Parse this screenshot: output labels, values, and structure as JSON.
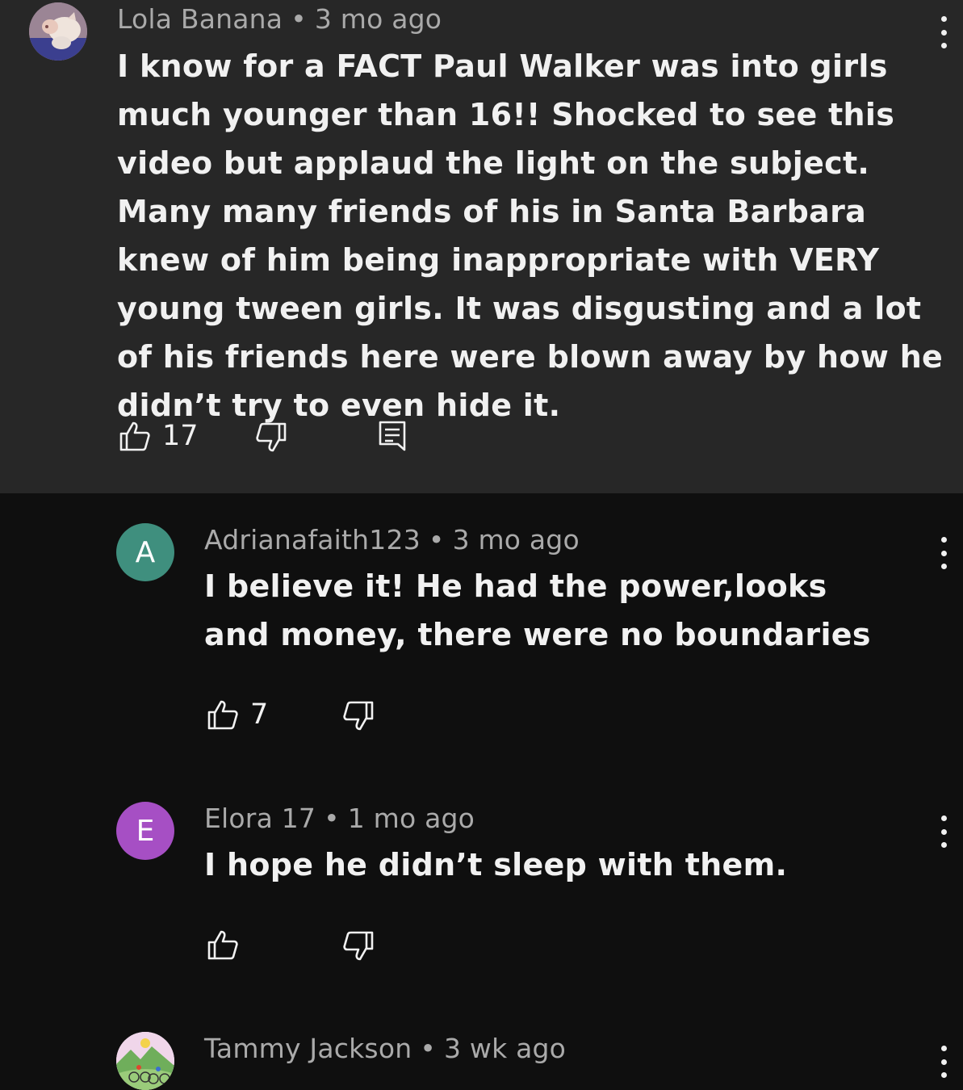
{
  "comments": [
    {
      "author": "Lola Banana",
      "time": "3 mo ago",
      "text": "I know for a FACT Paul Walker was into girls much younger than 16!! Shocked to see this video but applaud the light on the subject. Many many friends of his in Santa Barbara knew of him being inappropriate with VERY young tween girls. It was disgusting and a lot of his friends here were blown away by how he didn’t try to even hide it.",
      "likes": "17",
      "avatar_icon": "pig-photo-avatar"
    },
    {
      "author": "Adrianafaith123",
      "time": "3 mo ago",
      "text": "I believe it! He had the power,looks and money, there were no boundaries",
      "likes": "7",
      "avatar_letter": "A",
      "avatar_color": "#3f8f7e"
    },
    {
      "author": "Elora 17",
      "time": "1 mo ago",
      "text": "I hope he didn’t sleep with them.",
      "likes": "",
      "avatar_letter": "E",
      "avatar_color": "#a64fc4"
    },
    {
      "author": "Tammy Jackson",
      "time": "3 wk ago",
      "text": "",
      "avatar_icon": "cyclists-illustration-avatar"
    }
  ],
  "separator": "•",
  "colors": {
    "highlight_bg": "#272727",
    "page_bg": "#0f0f0f",
    "text": "#f1f1f1",
    "meta": "#aaaaaa"
  }
}
